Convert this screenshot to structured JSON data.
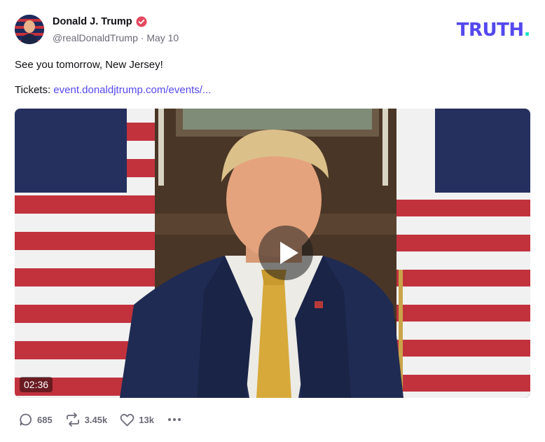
{
  "post": {
    "author_name": "Donald J. Trump",
    "handle": "@realDonaldTrump",
    "separator": "·",
    "date": "May 10",
    "text_line": "See you tomorrow, New Jersey!",
    "tickets_label": "Tickets: ",
    "tickets_link": "event.donaldjtrump.com/events/..."
  },
  "brand": {
    "logo_text": "TRUTH",
    "logo_dot": ".",
    "accent_color": "#5448ee",
    "dot_color": "#17e3c2",
    "verified_color": "#e5485f"
  },
  "media": {
    "duration": "02:36"
  },
  "actions": {
    "replies": "685",
    "retruths": "3.45k",
    "likes": "13k"
  },
  "icons": [
    "verified-badge-icon",
    "play-icon",
    "reply-icon",
    "retruth-icon",
    "like-icon",
    "more-icon"
  ]
}
